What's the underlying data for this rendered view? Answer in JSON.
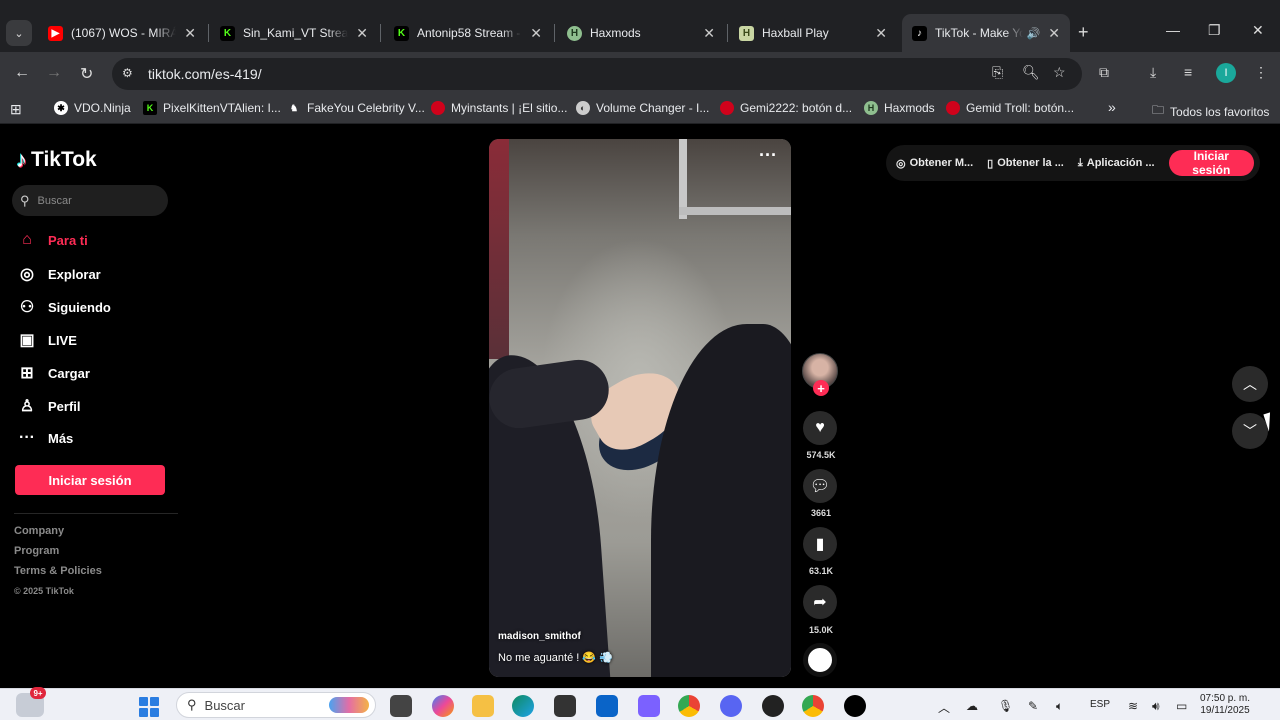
{
  "browser": {
    "tabs": [
      {
        "title": "(1067) WOS - MIRÁ N",
        "favicon": "youtube",
        "color": "#ff0000",
        "glyph": "▶"
      },
      {
        "title": "Sin_Kami_VT Stream",
        "favicon": "kick",
        "color": "#53fc18",
        "glyph": "K"
      },
      {
        "title": "Antonip58 Stream - V",
        "favicon": "kick",
        "color": "#53fc18",
        "glyph": "K"
      },
      {
        "title": "Haxmods",
        "favicon": "haxmods",
        "color": "#8fbf8f",
        "glyph": "H"
      },
      {
        "title": "Haxball Play",
        "favicon": "haxball",
        "color": "#c9d6a3",
        "glyph": "H"
      },
      {
        "title": "TikTok - Make Yo",
        "favicon": "tiktok",
        "color": "#000000",
        "glyph": "♪"
      }
    ],
    "new_tab": "+",
    "url": "tiktok.com/es-419/",
    "profile_initial": "I",
    "bookmarks": [
      {
        "label": "VDO.Ninja",
        "color": "#ffffff",
        "glyph": "✱"
      },
      {
        "label": "PixelKittenVTAlien: I...",
        "color": "#53fc18",
        "glyph": "K"
      },
      {
        "label": "FakeYou Celebrity V...",
        "color": "#ffffff",
        "glyph": "♞"
      },
      {
        "label": "Myinstants | ¡El sitio...",
        "color": "#d0021b",
        "glyph": "●"
      },
      {
        "label": "Volume Changer - I...",
        "color": "#cccccc",
        "glyph": "◐"
      },
      {
        "label": "Gemi2222: botón d...",
        "color": "#d0021b",
        "glyph": "●"
      },
      {
        "label": "Haxmods",
        "color": "#8fbf8f",
        "glyph": "H"
      },
      {
        "label": "Gemid Troll: botón...",
        "color": "#d0021b",
        "glyph": "●"
      }
    ],
    "bookmarks_overflow": "»",
    "all_bookmarks": "Todos los favoritos"
  },
  "tiktok": {
    "logo": "TikTok",
    "search_placeholder": "Buscar",
    "nav": [
      {
        "label": "Para ti",
        "icon": "home-icon",
        "glyph": "⌂",
        "active": true
      },
      {
        "label": "Explorar",
        "icon": "compass-icon",
        "glyph": "◎"
      },
      {
        "label": "Siguiendo",
        "icon": "following-icon",
        "glyph": "⚇"
      },
      {
        "label": "LIVE",
        "icon": "live-icon",
        "glyph": "▣"
      },
      {
        "label": "Cargar",
        "icon": "upload-icon",
        "glyph": "⊞"
      },
      {
        "label": "Perfil",
        "icon": "profile-icon",
        "glyph": "♙"
      },
      {
        "label": "Más",
        "icon": "more-icon",
        "glyph": "···"
      }
    ],
    "login_button": "Iniciar sesión",
    "footer": {
      "company": "Company",
      "program": "Program",
      "terms": "Terms & Policies",
      "copyright": "© 2025 TikTok"
    },
    "top_links": [
      {
        "label": "Obtener M...",
        "glyph": "◎"
      },
      {
        "label": "Obtener la ...",
        "glyph": "▯"
      },
      {
        "label": "Aplicación ...",
        "glyph": "⤓"
      }
    ],
    "top_login": "Iniciar sesión",
    "video": {
      "author": "madison_smithof",
      "caption": "No me aguanté ! 😂 💨",
      "more": "···"
    },
    "actions": {
      "likes": "574.5K",
      "comments": "3661",
      "saves": "63.1K",
      "shares": "15.0K"
    }
  },
  "taskbar": {
    "weather_badge": "9+",
    "search_placeholder": "Buscar",
    "lang": "ESP",
    "time": "07:50 p. m.",
    "date": "19/11/2025"
  },
  "colors": {
    "accent": "#fe2c55",
    "browser_bg": "#202124",
    "toolbar_bg": "#35363a"
  }
}
